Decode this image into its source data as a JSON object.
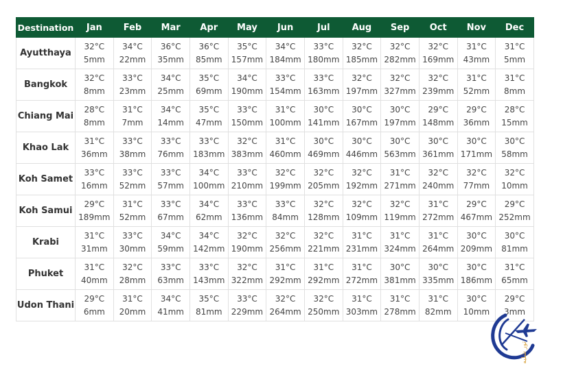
{
  "table": {
    "headers": [
      "Destination",
      "Jan",
      "Feb",
      "Mar",
      "Apr",
      "May",
      "Jun",
      "Jul",
      "Aug",
      "Sep",
      "Oct",
      "Nov",
      "Dec"
    ],
    "rows": [
      {
        "destination": "Ayutthaya",
        "temps": [
          "32°C",
          "34°C",
          "36°C",
          "36°C",
          "35°C",
          "34°C",
          "33°C",
          "32°C",
          "32°C",
          "32°C",
          "31°C",
          "31°C"
        ],
        "rain": [
          "5mm",
          "22mm",
          "35mm",
          "85mm",
          "157mm",
          "184mm",
          "180mm",
          "185mm",
          "282mm",
          "169mm",
          "43mm",
          "5mm"
        ]
      },
      {
        "destination": "Bangkok",
        "temps": [
          "32°C",
          "33°C",
          "34°C",
          "35°C",
          "34°C",
          "33°C",
          "33°C",
          "32°C",
          "32°C",
          "32°C",
          "31°C",
          "31°C"
        ],
        "rain": [
          "8mm",
          "23mm",
          "25mm",
          "69mm",
          "190mm",
          "154mm",
          "163mm",
          "197mm",
          "327mm",
          "239mm",
          "52mm",
          "8mm"
        ]
      },
      {
        "destination": "Chiang Mai",
        "temps": [
          "28°C",
          "31°C",
          "34°C",
          "35°C",
          "33°C",
          "31°C",
          "30°C",
          "30°C",
          "30°C",
          "29°C",
          "29°C",
          "28°C"
        ],
        "rain": [
          "8mm",
          "7mm",
          "14mm",
          "47mm",
          "150mm",
          "100mm",
          "141mm",
          "167mm",
          "197mm",
          "148mm",
          "36mm",
          "15mm"
        ]
      },
      {
        "destination": "Khao Lak",
        "temps": [
          "31°C",
          "33°C",
          "33°C",
          "33°C",
          "32°C",
          "31°C",
          "30°C",
          "30°C",
          "30°C",
          "30°C",
          "30°C",
          "30°C"
        ],
        "rain": [
          "36mm",
          "38mm",
          "76mm",
          "183mm",
          "383mm",
          "460mm",
          "469mm",
          "446mm",
          "563mm",
          "361mm",
          "171mm",
          "58mm"
        ]
      },
      {
        "destination": "Koh Samet",
        "temps": [
          "33°C",
          "33°C",
          "33°C",
          "34°C",
          "33°C",
          "32°C",
          "32°C",
          "32°C",
          "31°C",
          "32°C",
          "32°C",
          "32°C"
        ],
        "rain": [
          "16mm",
          "52mm",
          "57mm",
          "100mm",
          "210mm",
          "199mm",
          "205mm",
          "192mm",
          "271mm",
          "240mm",
          "77mm",
          "10mm"
        ]
      },
      {
        "destination": "Koh Samui",
        "temps": [
          "29°C",
          "31°C",
          "33°C",
          "34°C",
          "33°C",
          "33°C",
          "32°C",
          "32°C",
          "32°C",
          "31°C",
          "29°C",
          "29°C"
        ],
        "rain": [
          "189mm",
          "52mm",
          "67mm",
          "62mm",
          "136mm",
          "84mm",
          "128mm",
          "109mm",
          "119mm",
          "272mm",
          "467mm",
          "252mm"
        ]
      },
      {
        "destination": "Krabi",
        "temps": [
          "31°C",
          "33°C",
          "34°C",
          "34°C",
          "32°C",
          "32°C",
          "32°C",
          "31°C",
          "31°C",
          "31°C",
          "30°C",
          "30°C"
        ],
        "rain": [
          "31mm",
          "30mm",
          "59mm",
          "142mm",
          "190mm",
          "256mm",
          "221mm",
          "231mm",
          "324mm",
          "264mm",
          "209mm",
          "81mm"
        ]
      },
      {
        "destination": "Phuket",
        "temps": [
          "31°C",
          "32°C",
          "33°C",
          "33°C",
          "32°C",
          "31°C",
          "31°C",
          "31°C",
          "30°C",
          "30°C",
          "30°C",
          "31°C"
        ],
        "rain": [
          "40mm",
          "28mm",
          "63mm",
          "143mm",
          "322mm",
          "292mm",
          "292mm",
          "272mm",
          "381mm",
          "335mm",
          "186mm",
          "65mm"
        ]
      },
      {
        "destination": "Udon Thani",
        "temps": [
          "29°C",
          "31°C",
          "34°C",
          "35°C",
          "33°C",
          "32°C",
          "32°C",
          "31°C",
          "31°C",
          "31°C",
          "30°C",
          "29°C"
        ],
        "rain": [
          "6mm",
          "20mm",
          "41mm",
          "81mm",
          "229mm",
          "264mm",
          "250mm",
          "303mm",
          "278mm",
          "82mm",
          "10mm",
          "3mm"
        ]
      }
    ]
  },
  "watermark": {
    "text": "تور شلیمار",
    "icon": "airplane-globe-logo",
    "colors": {
      "primary": "#1f3a93",
      "accent": "#d9a441"
    }
  },
  "colors": {
    "header_bg": "#0e5a34",
    "header_text": "#ffffff",
    "border": "#e0e0e0"
  }
}
